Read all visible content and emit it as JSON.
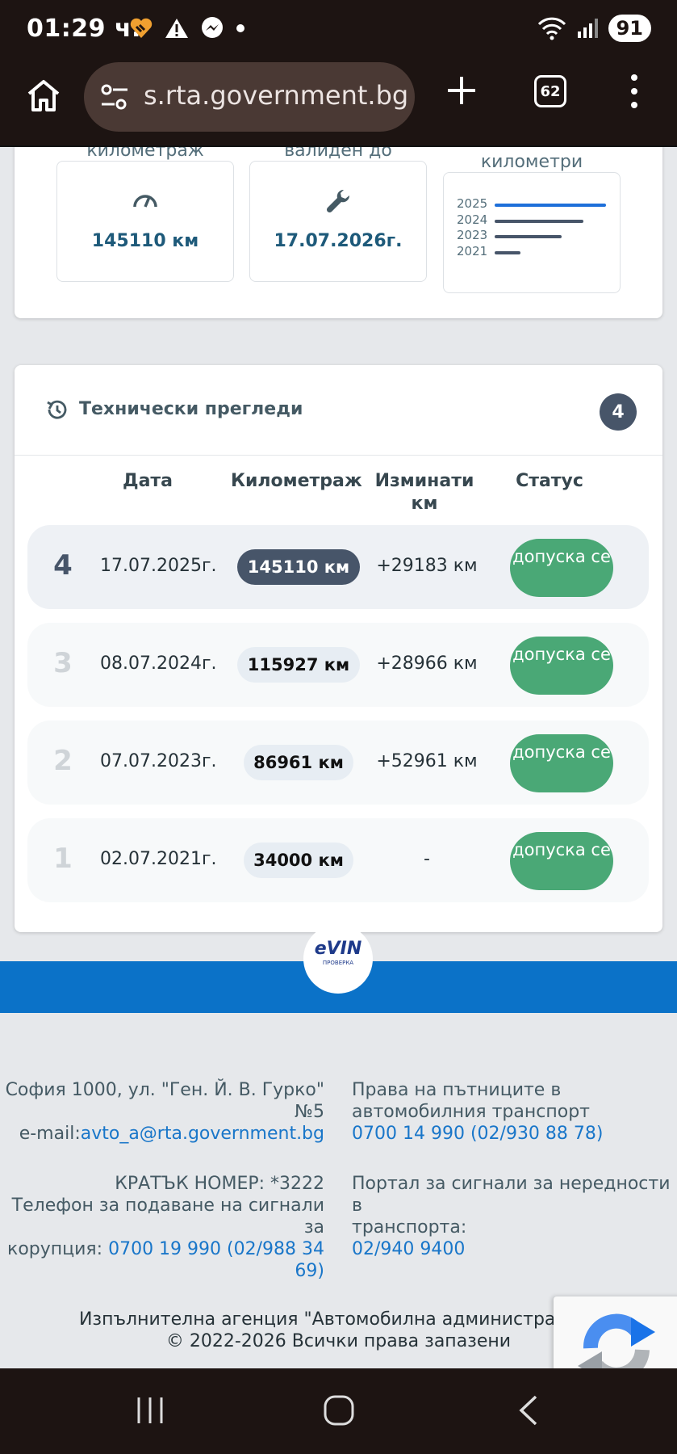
{
  "status_bar": {
    "time": "01:29 ч.",
    "battery": "91",
    "icons": [
      "heart-icon",
      "warning-icon",
      "messenger-icon",
      "dot-icon",
      "wifi-icon",
      "signal-icon"
    ]
  },
  "browser": {
    "url": "s.rta.government.bg",
    "tab_count": "62"
  },
  "summary": {
    "mileage_label": "километраж",
    "mileage_value": "145110 км",
    "valid_label": "валиден до",
    "valid_value": "17.07.2026г.",
    "chart_label": "километри",
    "years": [
      "2025",
      "2024",
      "2023",
      "2021"
    ],
    "year_km": [
      145110,
      115927,
      86961,
      34000
    ],
    "bar_colors": [
      "#1e6fd9",
      "#475569",
      "#475569",
      "#475569"
    ]
  },
  "inspections": {
    "title": "Технически прегледи",
    "count": "4",
    "headers": {
      "date": "Дата",
      "mileage": "Километраж",
      "traveled": "Изминати км",
      "status": "Статус"
    },
    "rows": [
      {
        "num": "4",
        "date": "17.07.2025г.",
        "km": "145110 км",
        "diff": "+29183 км",
        "status": "допуска се"
      },
      {
        "num": "3",
        "date": "08.07.2024г.",
        "km": "115927 км",
        "diff": "+28966 км",
        "status": "допуска се"
      },
      {
        "num": "2",
        "date": "07.07.2023г.",
        "km": "86961 км",
        "diff": "+52961 км",
        "status": "допуска се"
      },
      {
        "num": "1",
        "date": "02.07.2021г.",
        "km": "34000 км",
        "diff": "-",
        "status": "допуска се"
      }
    ]
  },
  "logo": {
    "text": "eVIN",
    "sub": "ПРОВЕРКА"
  },
  "footer": {
    "address_1": "София 1000, ул. \"Ген. Й. В. Гурко\"",
    "address_2": "№5",
    "email_label": "e-mail:",
    "email": "avto_a@rta.government.bg",
    "rights_1": "Права на пътниците в",
    "rights_2": "автомобилния транспорт",
    "rights_phone": "0700 14 990 (02/930 88 78)",
    "short_number": "КРАТЪК НОМЕР: *3222",
    "corruption_1": "Телефон за подаване на сигнали за",
    "corruption_2": "корупция: ",
    "corruption_phone_1": "0700 19 990 (02/988 34",
    "corruption_phone_2": "69)",
    "portal_1": "Портал за сигнали за нередности в",
    "portal_2": "транспорта:",
    "portal_phone": "02/940 9400",
    "agency": "Изпълнителна агенция \"Автомобилна администрация\"",
    "copyright": "© 2022-2026 Всички права запазени"
  }
}
